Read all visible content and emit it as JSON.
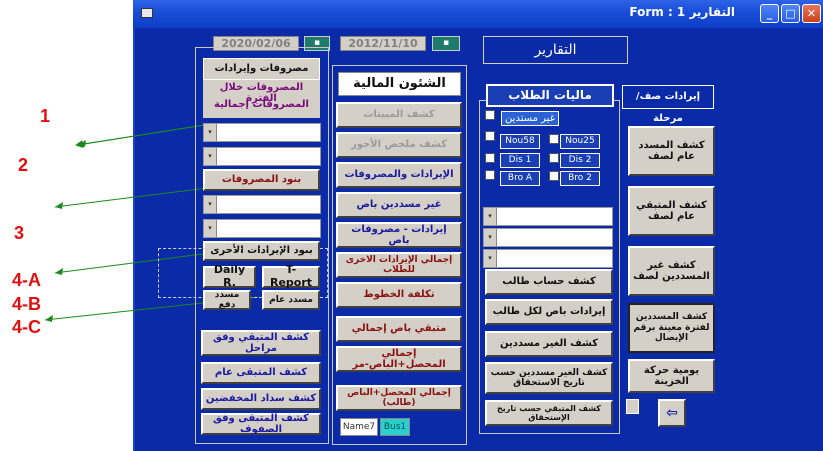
{
  "window": {
    "title": "التقارير 1 : Form"
  },
  "annotations": [
    "1",
    "2",
    "3",
    "4-A",
    "4-B",
    "4-C"
  ],
  "top": {
    "date1": "2020/02/06",
    "date2": "2012/11/10",
    "header": "التقارير"
  },
  "left_panel": {
    "title_box": "مصروفات وإيرادات إجمالية",
    "items": [
      "المصروفات خلال الفترة",
      "المصروفات إجمالية"
    ],
    "expense_items": "بنود المصروفات",
    "other_income": "بنود الإيرادات الأخرى",
    "daily": "Daily R.",
    "treport": "T-Report",
    "paid_payment": "مسدد دفع",
    "paid_year": "مسدد عام",
    "buttons": [
      "كشف المتبقي وفق مراحل",
      "كشف المتبقى عام",
      "كشف سداد المخفضين",
      "كشف المتبقى وفق الصفوف"
    ]
  },
  "finance_panel": {
    "title": "الشئون المالية",
    "buttons": [
      "كشف المبيتات",
      "كشف ملخص الأجور",
      "الإيرادات والمصروفات",
      "غير مسددين باص",
      "إيرادات - مصروفات باص",
      "إجمالي الإيرادات الاخرى للطلاب",
      "تكلفة الخطوط",
      "متبقي باص إجمالي",
      "إجمالي المحصل+الباص-مر",
      "إجمالي المحصل+الباص (طالب)"
    ],
    "bottom_left": "Name7",
    "bottom_right": "Bus1"
  },
  "students_panel": {
    "title": "ماليات الطلاب",
    "subtitle": "غير مستدين",
    "chips": [
      "Nou58",
      "Nou25",
      "Dis 1",
      "Dis 2",
      "Bro A",
      "Bro 2"
    ],
    "buttons": [
      "كشف حساب طالب",
      "إيرادات باص لكل طالب",
      "كشف الغير مسددين",
      "كشف الغير مسددين حسب تاريخ الاستحقاق",
      "كشف المتبقي حسب تاريخ الإستحقاق"
    ]
  },
  "right_panel": {
    "title": "إيرادات صف/مرحلة",
    "buttons": [
      "كشف المسدد عام لصف",
      "كشف المتبقي عام لصف",
      "كشف غير المسددين لصف",
      "كشف المسددين لفترة معينة برقم الإيصال",
      "يومية حركة الخزينة"
    ]
  }
}
